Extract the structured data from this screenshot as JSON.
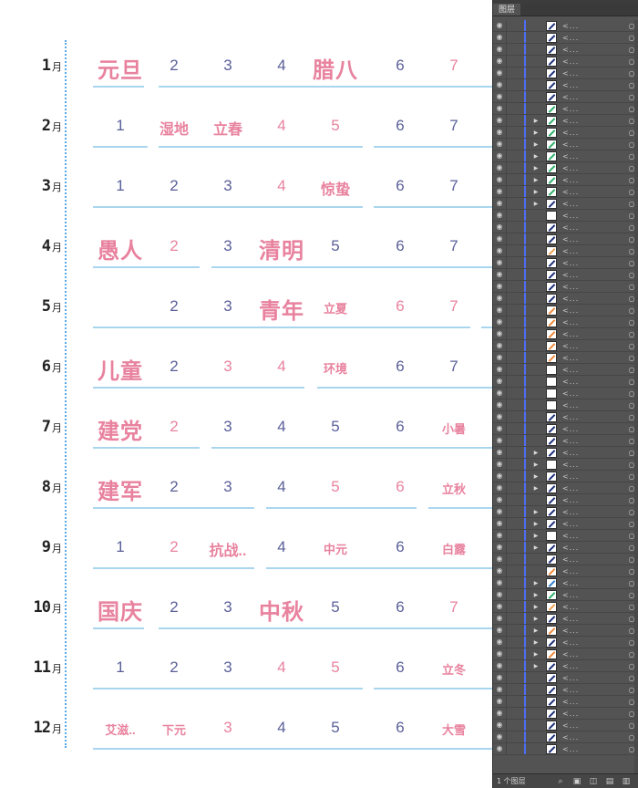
{
  "panel": {
    "tab_label": "图层",
    "layer_count": "1 个图层",
    "layer_name": "<...",
    "footer_icons": [
      "search-icon",
      "new-sublayer-icon",
      "clip-icon",
      "new-layer-icon",
      "delete-icon"
    ]
  },
  "colors": {
    "pink": "#e8829e",
    "blue": "#5a5f98",
    "underline": "#a9d6ee",
    "divider": "#5aa9e6"
  },
  "calendar": {
    "months": [
      {
        "label": "1",
        "suffix": "月",
        "cells": [
          {
            "t": "元旦",
            "c": "pink",
            "k": "lg"
          },
          {
            "t": "2",
            "c": "blue"
          },
          {
            "t": "3",
            "c": "blue"
          },
          {
            "t": "4",
            "c": "blue"
          },
          {
            "t": "腊八",
            "c": "pink",
            "k": "lg"
          },
          {
            "t": "6",
            "c": "blue"
          },
          {
            "t": "7",
            "c": "pink"
          }
        ]
      },
      {
        "label": "2",
        "suffix": "月",
        "cells": [
          {
            "t": "1",
            "c": "blue"
          },
          {
            "t": "湿地",
            "c": "pink",
            "k": "md"
          },
          {
            "t": "立春",
            "c": "pink",
            "k": "md"
          },
          {
            "t": "4",
            "c": "pink"
          },
          {
            "t": "5",
            "c": "pink"
          },
          {
            "t": "6",
            "c": "blue"
          },
          {
            "t": "7",
            "c": "blue"
          }
        ]
      },
      {
        "label": "3",
        "suffix": "月",
        "cells": [
          {
            "t": "1",
            "c": "blue"
          },
          {
            "t": "2",
            "c": "blue"
          },
          {
            "t": "3",
            "c": "blue"
          },
          {
            "t": "4",
            "c": "pink"
          },
          {
            "t": "惊蛰",
            "c": "pink",
            "k": "md"
          },
          {
            "t": "6",
            "c": "blue"
          },
          {
            "t": "7",
            "c": "blue"
          }
        ]
      },
      {
        "label": "4",
        "suffix": "月",
        "cells": [
          {
            "t": "愚人",
            "c": "pink",
            "k": "lg"
          },
          {
            "t": "2",
            "c": "pink"
          },
          {
            "t": "3",
            "c": "blue"
          },
          {
            "t": "清明",
            "c": "pink",
            "k": "lg"
          },
          {
            "t": "5",
            "c": "blue"
          },
          {
            "t": "6",
            "c": "blue"
          },
          {
            "t": "7",
            "c": "blue"
          }
        ]
      },
      {
        "label": "5",
        "suffix": "月",
        "cells": [
          {
            "t": "",
            "c": "blue"
          },
          {
            "t": "2",
            "c": "blue"
          },
          {
            "t": "3",
            "c": "blue"
          },
          {
            "t": "青年",
            "c": "pink",
            "k": "lg"
          },
          {
            "t": "立夏",
            "c": "pink",
            "k": "sm"
          },
          {
            "t": "6",
            "c": "pink"
          },
          {
            "t": "7",
            "c": "pink"
          }
        ]
      },
      {
        "label": "6",
        "suffix": "月",
        "cells": [
          {
            "t": "儿童",
            "c": "pink",
            "k": "lg"
          },
          {
            "t": "2",
            "c": "blue"
          },
          {
            "t": "3",
            "c": "pink"
          },
          {
            "t": "4",
            "c": "pink"
          },
          {
            "t": "环境",
            "c": "pink",
            "k": "sm"
          },
          {
            "t": "6",
            "c": "blue"
          },
          {
            "t": "7",
            "c": "blue"
          }
        ]
      },
      {
        "label": "7",
        "suffix": "月",
        "cells": [
          {
            "t": "建党",
            "c": "pink",
            "k": "lg"
          },
          {
            "t": "2",
            "c": "pink"
          },
          {
            "t": "3",
            "c": "blue"
          },
          {
            "t": "4",
            "c": "blue"
          },
          {
            "t": "5",
            "c": "blue"
          },
          {
            "t": "6",
            "c": "blue"
          },
          {
            "t": "小暑",
            "c": "pink",
            "k": "sm"
          }
        ]
      },
      {
        "label": "8",
        "suffix": "月",
        "cells": [
          {
            "t": "建军",
            "c": "pink",
            "k": "lg"
          },
          {
            "t": "2",
            "c": "blue"
          },
          {
            "t": "3",
            "c": "blue"
          },
          {
            "t": "4",
            "c": "blue"
          },
          {
            "t": "5",
            "c": "pink"
          },
          {
            "t": "6",
            "c": "pink"
          },
          {
            "t": "立秋",
            "c": "pink",
            "k": "sm"
          }
        ]
      },
      {
        "label": "9",
        "suffix": "月",
        "cells": [
          {
            "t": "1",
            "c": "blue"
          },
          {
            "t": "2",
            "c": "pink"
          },
          {
            "t": "抗战..",
            "c": "pink",
            "k": "md"
          },
          {
            "t": "4",
            "c": "blue"
          },
          {
            "t": "中元",
            "c": "pink",
            "k": "sm"
          },
          {
            "t": "6",
            "c": "blue"
          },
          {
            "t": "白露",
            "c": "pink",
            "k": "sm"
          }
        ]
      },
      {
        "label": "10",
        "suffix": "月",
        "cells": [
          {
            "t": "国庆",
            "c": "pink",
            "k": "lg"
          },
          {
            "t": "2",
            "c": "blue"
          },
          {
            "t": "3",
            "c": "blue"
          },
          {
            "t": "中秋",
            "c": "pink",
            "k": "lg"
          },
          {
            "t": "5",
            "c": "blue"
          },
          {
            "t": "6",
            "c": "blue"
          },
          {
            "t": "7",
            "c": "pink"
          }
        ]
      },
      {
        "label": "11",
        "suffix": "月",
        "cells": [
          {
            "t": "1",
            "c": "blue"
          },
          {
            "t": "2",
            "c": "blue"
          },
          {
            "t": "3",
            "c": "blue"
          },
          {
            "t": "4",
            "c": "pink"
          },
          {
            "t": "5",
            "c": "pink"
          },
          {
            "t": "6",
            "c": "blue"
          },
          {
            "t": "立冬",
            "c": "pink",
            "k": "sm"
          }
        ]
      },
      {
        "label": "12",
        "suffix": "月",
        "cells": [
          {
            "t": "艾滋..",
            "c": "pink",
            "k": "sm"
          },
          {
            "t": "下元",
            "c": "pink",
            "k": "sm"
          },
          {
            "t": "3",
            "c": "pink"
          },
          {
            "t": "4",
            "c": "blue"
          },
          {
            "t": "5",
            "c": "blue"
          },
          {
            "t": "6",
            "c": "blue"
          },
          {
            "t": "大雪",
            "c": "pink",
            "k": "sm"
          }
        ]
      }
    ]
  }
}
